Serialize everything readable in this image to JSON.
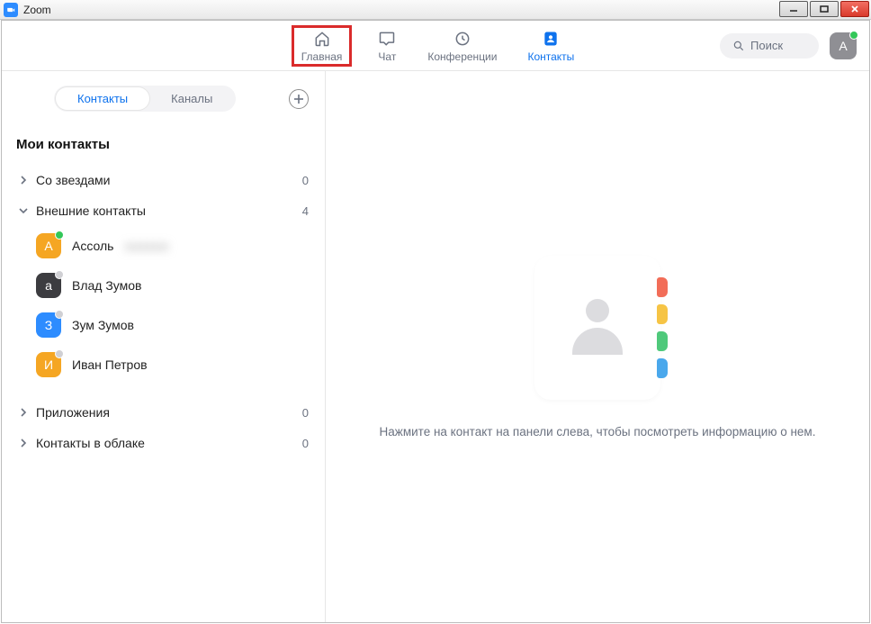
{
  "window": {
    "title": "Zoom"
  },
  "nav": {
    "home": "Главная",
    "chat": "Чат",
    "meetings": "Конференции",
    "contacts": "Контакты"
  },
  "search": {
    "placeholder": "Поиск"
  },
  "user_avatar": {
    "letter": "A"
  },
  "subtabs": {
    "contacts": "Контакты",
    "channels": "Каналы"
  },
  "section_title": "Мои контакты",
  "groups": {
    "starred": {
      "label": "Со звездами",
      "count": "0",
      "expanded": false
    },
    "external": {
      "label": "Внешние контакты",
      "count": "4",
      "expanded": true
    },
    "apps": {
      "label": "Приложения",
      "count": "0",
      "expanded": false
    },
    "cloud": {
      "label": "Контакты в облаке",
      "count": "0",
      "expanded": false
    }
  },
  "contacts": [
    {
      "initial": "А",
      "name": "Ассоль",
      "color": "#f5a623",
      "presence": "online",
      "blurred_extra": true
    },
    {
      "initial": "а",
      "name": "Влад Зумов",
      "color": "#3c3c40",
      "presence": "offline"
    },
    {
      "initial": "З",
      "name": "Зум Зумов",
      "color": "#2d8cff",
      "presence": "offline"
    },
    {
      "initial": "И",
      "name": "Иван Петров",
      "color": "#f5a623",
      "presence": "offline"
    }
  ],
  "empty_text": "Нажмите на контакт на панели слева, чтобы посмотреть информацию о нем."
}
